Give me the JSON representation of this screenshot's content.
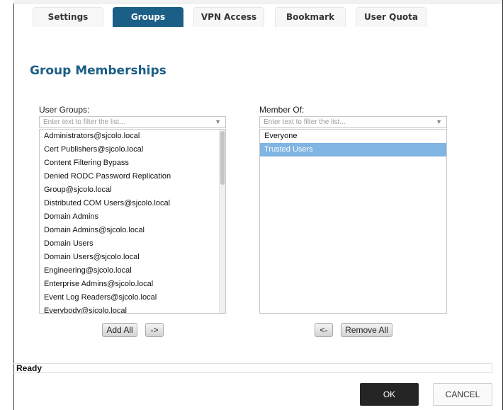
{
  "tabs": [
    {
      "label": "Settings",
      "active": false
    },
    {
      "label": "Groups",
      "active": true
    },
    {
      "label": "VPN Access",
      "active": false
    },
    {
      "label": "Bookmark",
      "active": false
    },
    {
      "label": "User Quota",
      "active": false
    }
  ],
  "section_title": "Group Memberships",
  "user_groups": {
    "label": "User Groups:",
    "filter_placeholder": "Enter text to filter the list...",
    "items": [
      "Administrators@sjcolo.local",
      "Cert Publishers@sjcolo.local",
      "Content Filtering Bypass",
      "Denied RODC Password Replication",
      "Group@sjcolo.local",
      "Distributed COM Users@sjcolo.local",
      "Domain Admins",
      "Domain Admins@sjcolo.local",
      "Domain Users",
      "Domain Users@sjcolo.local",
      "Engineering@sjcolo.local",
      "Enterprise Admins@sjcolo.local",
      "Event Log Readers@sjcolo.local",
      "Everybody@sjcolo.local"
    ]
  },
  "member_of": {
    "label": "Member Of:",
    "filter_placeholder": "Enter text to filter the list...",
    "items": [
      "Everyone",
      "Trusted Users"
    ],
    "selected": "Trusted Users"
  },
  "buttons": {
    "add_all": "Add All",
    "add": "->",
    "remove": "<-",
    "remove_all": "Remove All",
    "ok": "OK",
    "cancel": "CANCEL"
  },
  "status": "Ready",
  "colors": {
    "accent": "#1b5e86",
    "selection": "#7fb4e3"
  }
}
